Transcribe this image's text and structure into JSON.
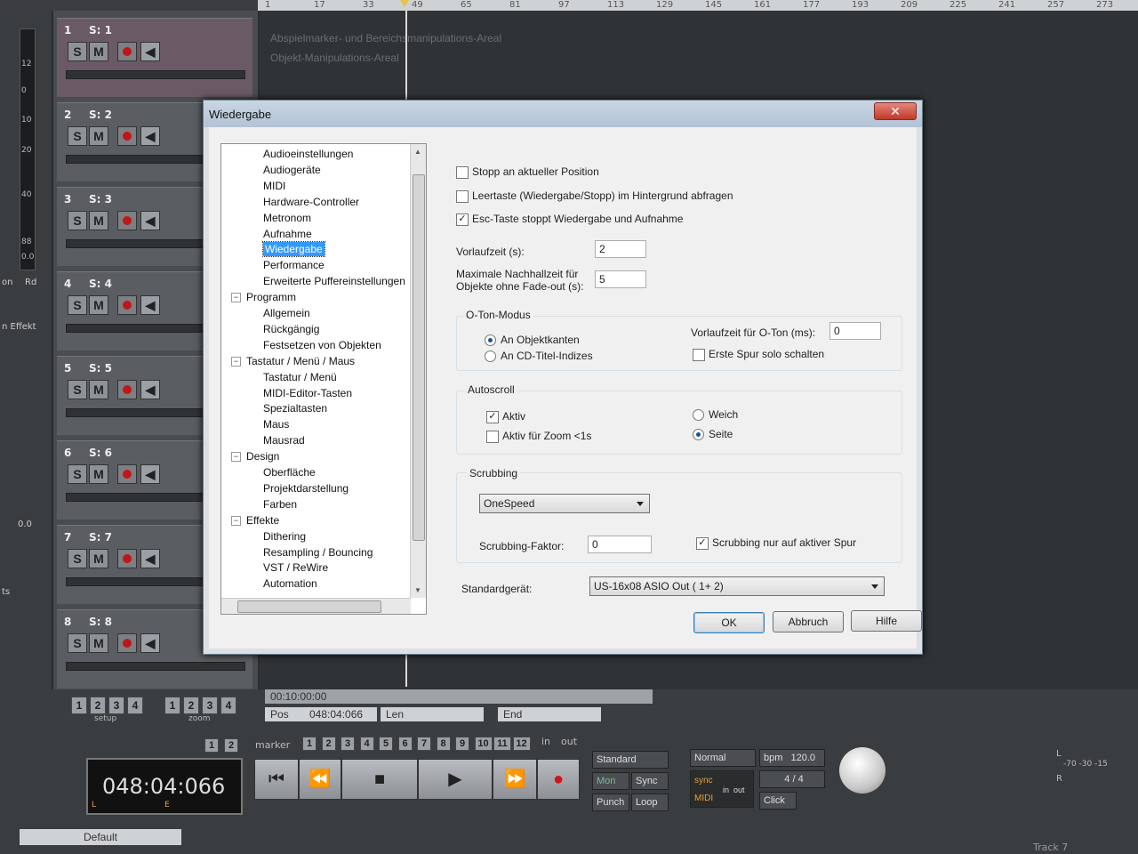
{
  "ruler": {
    "ticks": [
      "1",
      "17",
      "33",
      "49",
      "65",
      "81",
      "97",
      "113",
      "129",
      "145",
      "161",
      "177",
      "193",
      "209",
      "225",
      "241",
      "257",
      "273"
    ]
  },
  "left_side": {
    "meter_labels": [
      "12",
      "0",
      "10",
      "20",
      "40",
      "88",
      "0.0"
    ],
    "labels": [
      "on",
      "Rd",
      "n Effekt",
      "0.0",
      "ts"
    ]
  },
  "tracks": [
    {
      "num": "1",
      "name": "S: 1"
    },
    {
      "num": "2",
      "name": "S: 2"
    },
    {
      "num": "3",
      "name": "S: 3"
    },
    {
      "num": "4",
      "name": "S: 4"
    },
    {
      "num": "5",
      "name": "S: 5"
    },
    {
      "num": "6",
      "name": "S: 6"
    },
    {
      "num": "7",
      "name": "S: 7"
    },
    {
      "num": "8",
      "name": "S: 8"
    }
  ],
  "track_buttons": {
    "solo": "S",
    "mute": "M"
  },
  "arrange": {
    "hint1": "Abspielmarker- und Bereichsmanipulations-Areal",
    "hint2": "Objekt-Manipulations-Areal"
  },
  "bottom": {
    "setup_nums": [
      "1",
      "2",
      "3",
      "4"
    ],
    "setup_label": "setup",
    "zoom_nums": [
      "1",
      "2",
      "3",
      "4"
    ],
    "zoom_label": "zoom",
    "timecode": "00:10:00:00",
    "pos_label": "Pos",
    "pos_value": "048:04:066",
    "len_label": "Len",
    "end_label": "End"
  },
  "transport": {
    "time": "048:04:066",
    "lcd_l": "L",
    "lcd_e": "E",
    "marker_label": "marker",
    "marker_nums": [
      "1",
      "2",
      "3",
      "4",
      "5",
      "6",
      "7",
      "8",
      "9",
      "10",
      "11",
      "12"
    ],
    "in_label": "in",
    "out_label": "out",
    "left_nums": [
      "1",
      "2"
    ],
    "standard": "Standard",
    "mon": "Mon",
    "sync": "Sync",
    "punch": "Punch",
    "loop": "Loop",
    "normal": "Normal",
    "bpm_label": "bpm",
    "bpm_value": "120.0",
    "sig": "4 / 4",
    "click": "Click",
    "sync_lbl": "sync",
    "midi_lbl": "MIDI",
    "in_lbl": "in",
    "out_lbl": "out",
    "default": "Default",
    "track_label": "Track 7",
    "meter_l": "L",
    "meter_r": "R",
    "meter_scale": "-70  -30  -15"
  },
  "dialog": {
    "title": "Wiedergabe",
    "tree": [
      {
        "label": "Audioeinstellungen",
        "level": 2
      },
      {
        "label": "Audiogeräte",
        "level": 2
      },
      {
        "label": "MIDI",
        "level": 2
      },
      {
        "label": "Hardware-Controller",
        "level": 2
      },
      {
        "label": "Metronom",
        "level": 2
      },
      {
        "label": "Aufnahme",
        "level": 2
      },
      {
        "label": "Wiedergabe",
        "level": 2,
        "selected": true
      },
      {
        "label": "Performance",
        "level": 2
      },
      {
        "label": "Erweiterte Puffereinstellungen",
        "level": 2
      },
      {
        "label": "Programm",
        "level": 1
      },
      {
        "label": "Allgemein",
        "level": 2
      },
      {
        "label": "Rückgängig",
        "level": 2
      },
      {
        "label": "Festsetzen von Objekten",
        "level": 2
      },
      {
        "label": "Tastatur / Menü / Maus",
        "level": 1
      },
      {
        "label": "Tastatur / Menü",
        "level": 2
      },
      {
        "label": "MIDI-Editor-Tasten",
        "level": 2
      },
      {
        "label": "Spezialtasten",
        "level": 2
      },
      {
        "label": "Maus",
        "level": 2
      },
      {
        "label": "Mausrad",
        "level": 2
      },
      {
        "label": "Design",
        "level": 1
      },
      {
        "label": "Oberfläche",
        "level": 2
      },
      {
        "label": "Projektdarstellung",
        "level": 2
      },
      {
        "label": "Farben",
        "level": 2
      },
      {
        "label": "Effekte",
        "level": 1
      },
      {
        "label": "Dithering",
        "level": 2
      },
      {
        "label": "Resampling / Bouncing",
        "level": 2
      },
      {
        "label": "VST / ReWire",
        "level": 2
      },
      {
        "label": "Automation",
        "level": 2
      }
    ],
    "opts": {
      "stopp": "Stopp an aktueller Position",
      "leertaste": "Leertaste (Wiedergabe/Stopp) im Hintergrund abfragen",
      "esc": "Esc-Taste stoppt Wiedergabe und Aufnahme",
      "vorlauf_label": "Vorlaufzeit (s):",
      "vorlauf_value": "2",
      "nachhall_label1": "Maximale Nachhallzeit für",
      "nachhall_label2": "Objekte ohne Fade-out (s):",
      "nachhall_value": "5"
    },
    "oton": {
      "title": "O-Ton-Modus",
      "r1": "An Objektkanten",
      "r2": "An CD-Titel-Indizes",
      "vorlauf_label": "Vorlaufzeit für O-Ton (ms):",
      "vorlauf_value": "0",
      "solo": "Erste Spur solo schalten"
    },
    "autoscroll": {
      "title": "Autoscroll",
      "aktiv": "Aktiv",
      "zoom": "Aktiv für Zoom <1s",
      "weich": "Weich",
      "seite": "Seite"
    },
    "scrubbing": {
      "title": "Scrubbing",
      "mode": "OneSpeed",
      "faktor_label": "Scrubbing-Faktor:",
      "faktor_value": "0",
      "nur_aktiv": "Scrubbing nur auf aktiver Spur"
    },
    "device": {
      "label": "Standardgerät:",
      "value": "US-16x08 ASIO Out ( 1+ 2)"
    },
    "buttons": {
      "ok": "OK",
      "cancel": "Abbruch",
      "help": "Hilfe"
    }
  }
}
